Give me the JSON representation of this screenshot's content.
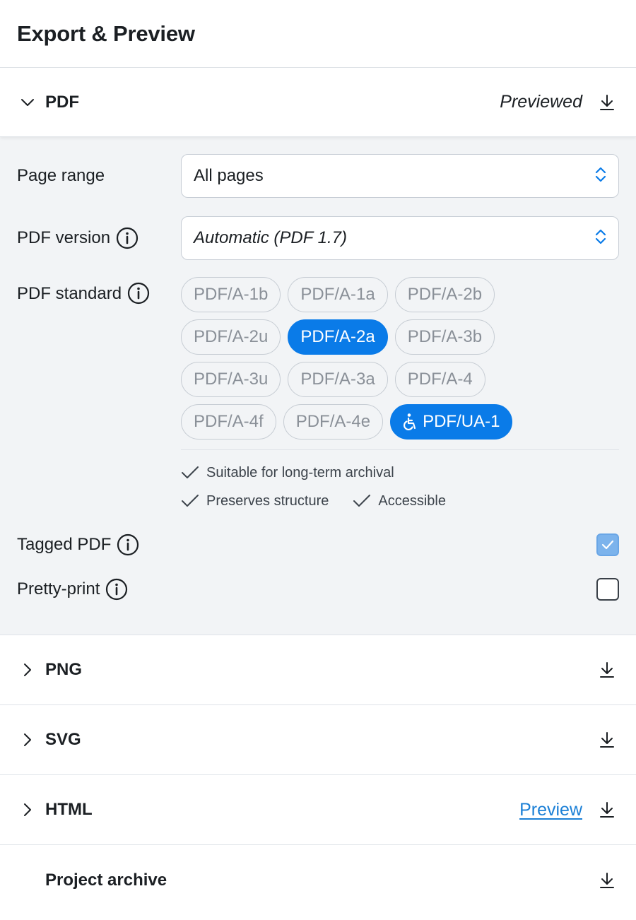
{
  "panel": {
    "title": "Export & Preview"
  },
  "pdf": {
    "title": "PDF",
    "status": "Previewed",
    "page_range": {
      "label": "Page range",
      "value": "All pages"
    },
    "pdf_version": {
      "label": "PDF version",
      "value": "Automatic (PDF 1.7)"
    },
    "pdf_standard": {
      "label": "PDF standard",
      "chips": [
        {
          "label": "PDF/A-1b",
          "selected": false
        },
        {
          "label": "PDF/A-1a",
          "selected": false
        },
        {
          "label": "PDF/A-2b",
          "selected": false
        },
        {
          "label": "PDF/A-2u",
          "selected": false
        },
        {
          "label": "PDF/A-2a",
          "selected": true
        },
        {
          "label": "PDF/A-3b",
          "selected": false
        },
        {
          "label": "PDF/A-3u",
          "selected": false
        },
        {
          "label": "PDF/A-3a",
          "selected": false
        },
        {
          "label": "PDF/A-4",
          "selected": false
        },
        {
          "label": "PDF/A-4f",
          "selected": false
        },
        {
          "label": "PDF/A-4e",
          "selected": false
        },
        {
          "label": "PDF/UA-1",
          "selected": true,
          "icon": "accessibility-icon"
        }
      ]
    },
    "features": [
      "Suitable for long-term archival",
      "Preserves structure",
      "Accessible"
    ],
    "tagged_pdf": {
      "label": "Tagged PDF",
      "checked": true
    },
    "pretty_print": {
      "label": "Pretty-print",
      "checked": false
    }
  },
  "sections": [
    {
      "title": "PNG"
    },
    {
      "title": "SVG"
    },
    {
      "title": "HTML",
      "link": "Preview"
    },
    {
      "title": "Project archive"
    }
  ],
  "colors": {
    "accent": "#0a7be8",
    "link": "#1a7fd6",
    "body_bg": "#f2f4f6",
    "checked_bg": "#7cb3ec"
  }
}
